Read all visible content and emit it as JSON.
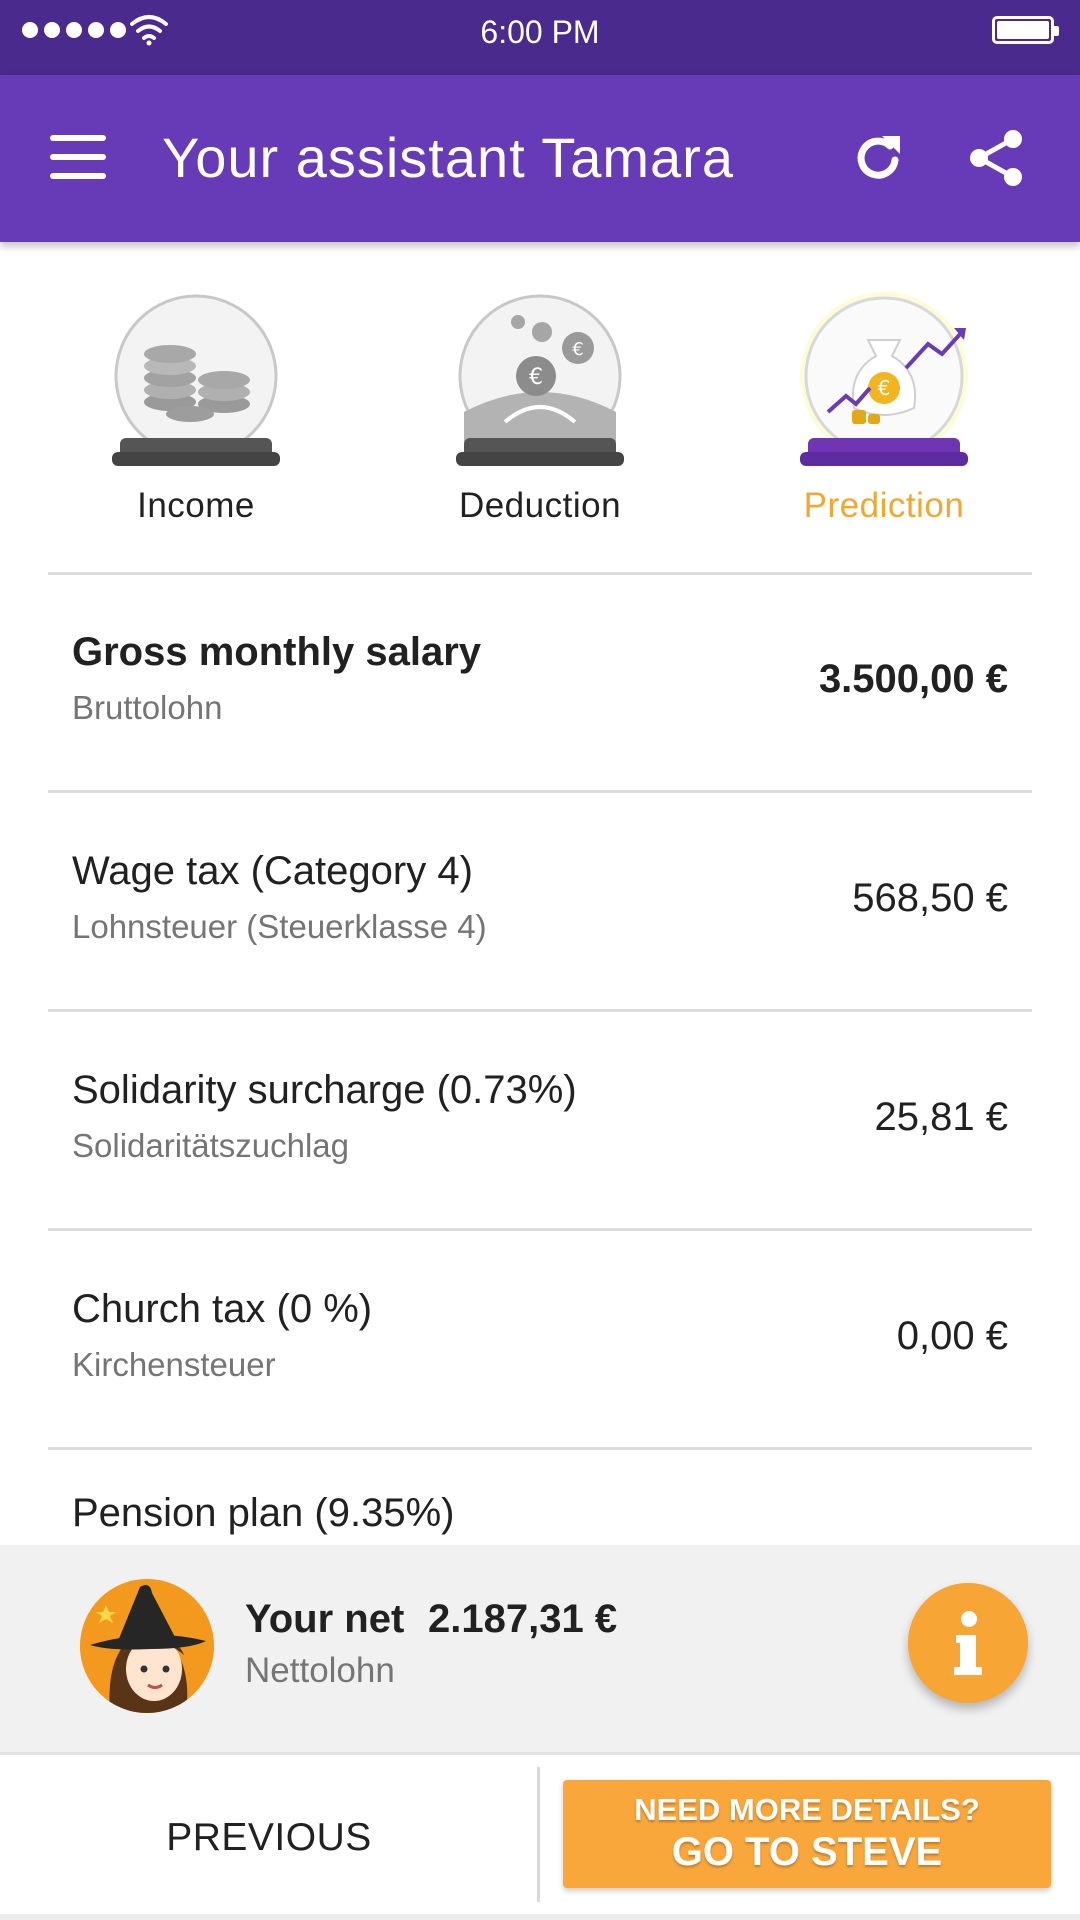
{
  "status_bar": {
    "time": "6:00 PM"
  },
  "app_bar": {
    "title": "Your assistant Tamara",
    "menu_icon": "hamburger-menu-icon",
    "refresh_icon": "refresh-icon",
    "share_icon": "share-icon"
  },
  "tabs": [
    {
      "label": "Income",
      "icon": "coins-globe-icon",
      "active": false
    },
    {
      "label": "Deduction",
      "icon": "euro-coins-globe-icon",
      "active": false
    },
    {
      "label": "Prediction",
      "icon": "money-bag-growth-globe-icon",
      "active": true
    }
  ],
  "rows": [
    {
      "title": "Gross monthly salary",
      "subtitle": "Bruttolohn",
      "amount": "3.500,00 €"
    },
    {
      "title": "Wage tax (Category 4)",
      "subtitle": "Lohnsteuer (Steuerklasse 4)",
      "amount": "568,50 €"
    },
    {
      "title": "Solidarity surcharge (0.73%)",
      "subtitle": "Solidaritätszuchlag",
      "amount": "25,81 €"
    },
    {
      "title": "Church tax (0 %)",
      "subtitle": "Kirchensteuer",
      "amount": "0,00 €"
    },
    {
      "title": "Pension plan (9.35%)",
      "subtitle": "",
      "amount": ""
    }
  ],
  "net": {
    "label": "Your net",
    "value": "2.187,31 €",
    "subtitle": "Nettolohn",
    "avatar": "witch-assistant-avatar",
    "info_icon": "info-icon"
  },
  "footer": {
    "previous_label": "PREVIOUS",
    "steve_line1": "NEED MORE DETAILS?",
    "steve_line2": "GO TO STEVE"
  },
  "colors": {
    "status_bar": "#4a2a8c",
    "app_bar": "#673ab7",
    "accent_orange": "#f9a73b",
    "active_tab": "#f0a830"
  }
}
